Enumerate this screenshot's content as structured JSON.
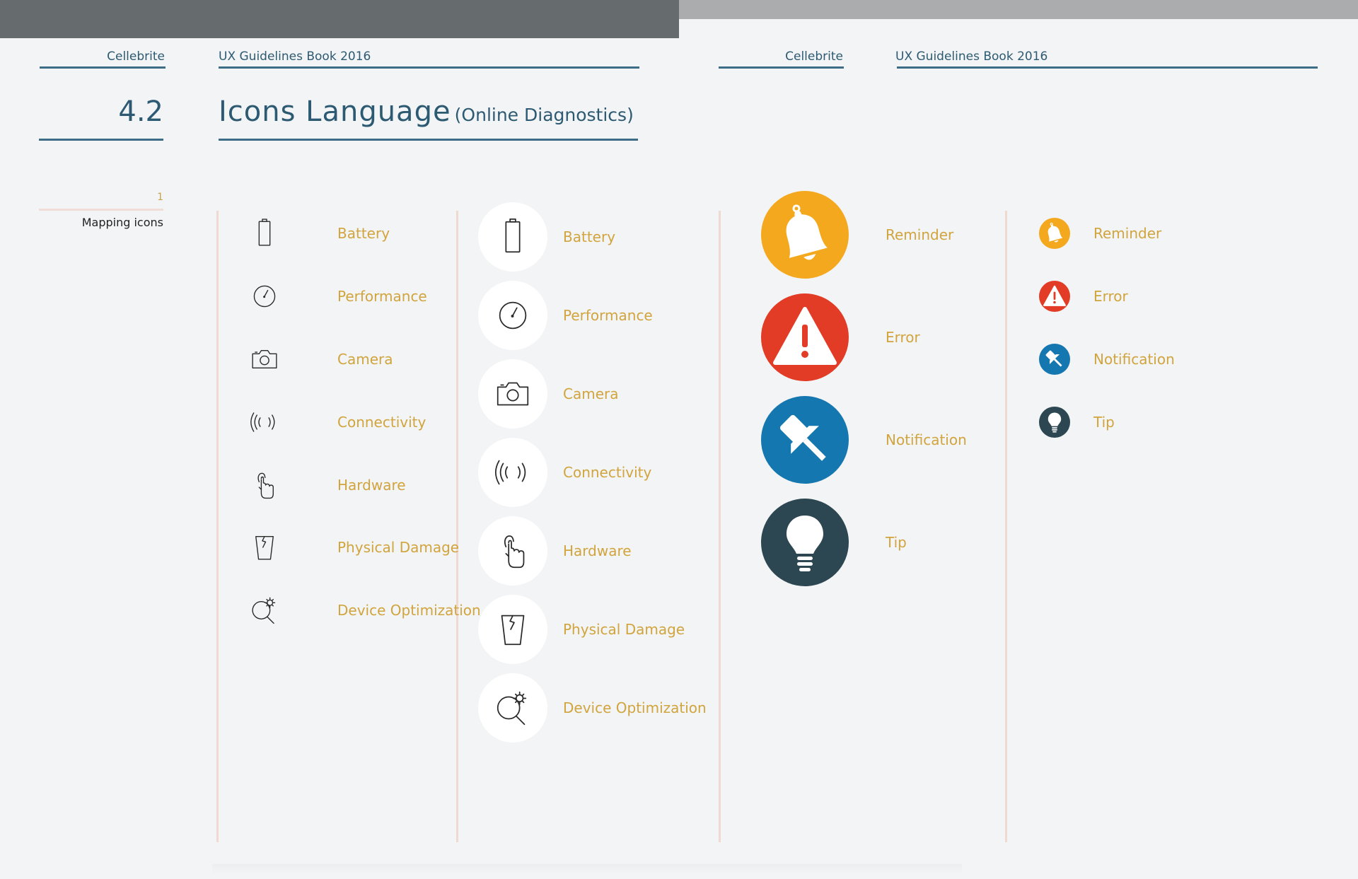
{
  "header": {
    "left_brand": "Cellebrite",
    "left_book": "UX Guidelines Book 2016",
    "right_brand": "Cellebrite",
    "right_book": "UX Guidelines Book 2016"
  },
  "section": {
    "number": "4.2",
    "title": "Icons Language",
    "subtitle": "(Online Diagnostics)"
  },
  "toc": {
    "number": "1",
    "label": "Mapping icons"
  },
  "outline_icons": [
    {
      "icon": "battery-icon",
      "label": "Battery"
    },
    {
      "icon": "performance-icon",
      "label": "Performance"
    },
    {
      "icon": "camera-icon",
      "label": "Camera"
    },
    {
      "icon": "connectivity-icon",
      "label": "Connectivity"
    },
    {
      "icon": "hardware-icon",
      "label": "Hardware"
    },
    {
      "icon": "physical-damage-icon",
      "label": "Physical Damage"
    },
    {
      "icon": "device-optimization-icon",
      "label": "Device Optimization"
    }
  ],
  "circle_icons": [
    {
      "icon": "battery-icon",
      "label": "Battery"
    },
    {
      "icon": "performance-icon",
      "label": "Performance"
    },
    {
      "icon": "camera-icon",
      "label": "Camera"
    },
    {
      "icon": "connectivity-icon",
      "label": "Connectivity"
    },
    {
      "icon": "hardware-icon",
      "label": "Hardware"
    },
    {
      "icon": "physical-damage-icon",
      "label": "Physical Damage"
    },
    {
      "icon": "device-optimization-icon",
      "label": "Device Optimization"
    }
  ],
  "status_icons_large": [
    {
      "icon": "bell-icon",
      "label": "Reminder",
      "color": "#f4a81d"
    },
    {
      "icon": "warning-icon",
      "label": "Error",
      "color": "#e23c26"
    },
    {
      "icon": "pushpin-icon",
      "label": "Notification",
      "color": "#1577b0"
    },
    {
      "icon": "lightbulb-icon",
      "label": "Tip",
      "color": "#2c4752"
    }
  ],
  "status_icons_small": [
    {
      "icon": "bell-icon",
      "label": "Reminder",
      "color": "#f4a81d"
    },
    {
      "icon": "warning-icon",
      "label": "Error",
      "color": "#e23c26"
    },
    {
      "icon": "pushpin-icon",
      "label": "Notification",
      "color": "#1577b0"
    },
    {
      "icon": "lightbulb-icon",
      "label": "Tip",
      "color": "#2c4752"
    }
  ],
  "colors": {
    "heading": "#2d5a73",
    "label": "#d1a43d",
    "divider": "#f0d9d1"
  }
}
